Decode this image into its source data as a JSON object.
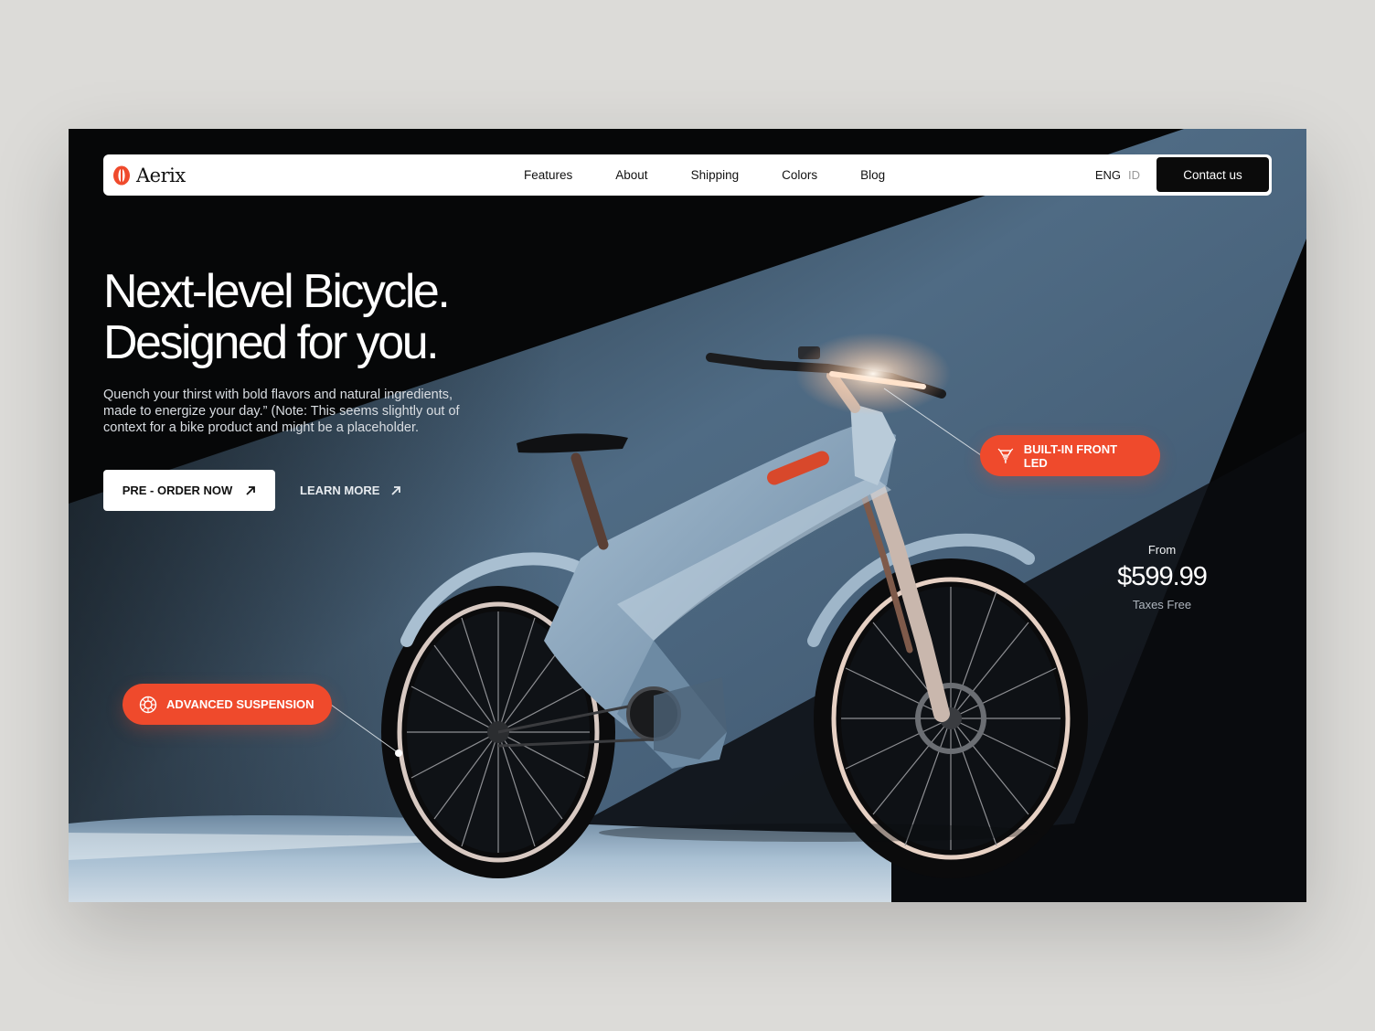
{
  "brand": {
    "name": "Aerix",
    "logo_icon": "aerix-logo-icon",
    "accent": "#ef4a2c"
  },
  "nav": {
    "items": [
      {
        "label": "Features"
      },
      {
        "label": "About"
      },
      {
        "label": "Shipping"
      },
      {
        "label": "Colors"
      },
      {
        "label": "Blog"
      }
    ],
    "lang_active": "ENG",
    "lang_inactive": "ID",
    "contact_label": "Contact us"
  },
  "hero": {
    "headline_line1": "Next-level Bicycle.",
    "headline_line2": "Designed for you.",
    "description": "Quench your thirst with bold flavors and natural ingredients, made to energize your day.” (Note: This seems slightly out of context for a bike product and might be a placeholder.",
    "primary_cta": "PRE - ORDER NOW",
    "secondary_cta": "LEARN MORE",
    "cta_icon": "arrow-up-right-icon"
  },
  "features": {
    "led": {
      "label": "BUILT-IN FRONT LED",
      "icon": "headlight-icon"
    },
    "suspension": {
      "label": "ADVANCED SUSPENSION",
      "icon": "suspension-icon"
    }
  },
  "pricing": {
    "from_label": "From",
    "price": "$599.99",
    "tax_label": "Taxes Free"
  },
  "colors": {
    "background": "#060708",
    "frame": "#8ea8c0",
    "accent": "#ef4a2c",
    "page": "#dcdbd8"
  }
}
